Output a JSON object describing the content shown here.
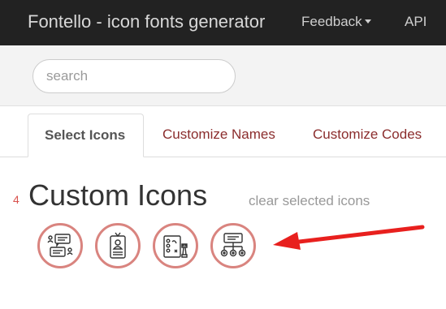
{
  "navbar": {
    "brand": "Fontello - icon fonts generator",
    "feedback": "Feedback",
    "api": "API"
  },
  "search": {
    "placeholder": "search",
    "value": ""
  },
  "tabs": [
    {
      "label": "Select Icons",
      "active": true
    },
    {
      "label": "Customize Names",
      "active": false
    },
    {
      "label": "Customize Codes",
      "active": false
    }
  ],
  "section": {
    "count": "4",
    "title": "Custom Icons",
    "clear_label": "clear selected icons"
  },
  "icons": [
    {
      "name": "chat-people-icon"
    },
    {
      "name": "id-card-person-icon"
    },
    {
      "name": "strategy-board-icon"
    },
    {
      "name": "org-chart-icon"
    }
  ],
  "colors": {
    "navbar_bg": "#222222",
    "tab_link": "#8b2d2d",
    "selected_ring": "#d9847f",
    "arrow": "#e8201e",
    "count": "#d9534f"
  }
}
